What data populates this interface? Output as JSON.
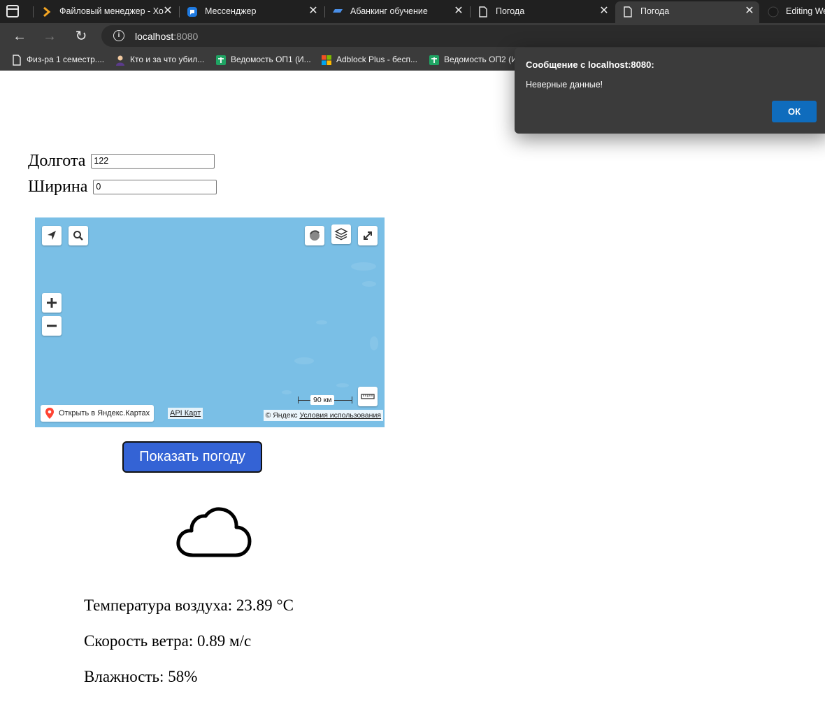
{
  "browser": {
    "tabs": [
      {
        "title": "Файловый менеджер - Хо",
        "icon": "chevron-right-icon"
      },
      {
        "title": "Мессенджер",
        "icon": "chat-icon"
      },
      {
        "title": "Абанкинг обучение",
        "icon": "stripe-logo-icon"
      },
      {
        "title": "Погода",
        "icon": "page-icon"
      },
      {
        "title": "Погода",
        "icon": "page-icon",
        "active": true
      },
      {
        "title": "Editing We",
        "icon": "github-icon"
      }
    ],
    "address": {
      "host": "localhost",
      "port": ":8080"
    },
    "bookmarks": [
      {
        "label": "Физ-ра 1 семестр....",
        "icon": "page-icon"
      },
      {
        "label": "Кто и за что убил...",
        "icon": "person-icon"
      },
      {
        "label": "Ведомость ОП1 (И...",
        "icon": "sheets-icon"
      },
      {
        "label": "Adblock Plus - бесп...",
        "icon": "windows-logo-icon"
      },
      {
        "label": "Ведомость ОП2 (И",
        "icon": "sheets-icon"
      }
    ]
  },
  "form": {
    "longitude_label": "Долгота",
    "longitude_value": "122",
    "latitude_label": "Ширина",
    "latitude_value": "0"
  },
  "map": {
    "open_in_maps": "Открыть в Яндекс.Картах",
    "api_link": "API Карт",
    "scale": "90 км",
    "copyright": "© Яндекс",
    "terms": "Условия использования",
    "water_color": "#7abfe6"
  },
  "button": {
    "label": "Показать погоду",
    "color": "#3463d5"
  },
  "weather": {
    "icon": "cloud-icon",
    "temperature": "Температура воздуха: 23.89 °C",
    "wind": "Скорость ветра: 0.89 м/с",
    "humidity": "Влажность: 58%"
  },
  "dialog": {
    "title": "Сообщение с localhost:8080:",
    "message": "Неверные данные!",
    "ok": "ОК",
    "ok_color": "#0f6cbd"
  }
}
